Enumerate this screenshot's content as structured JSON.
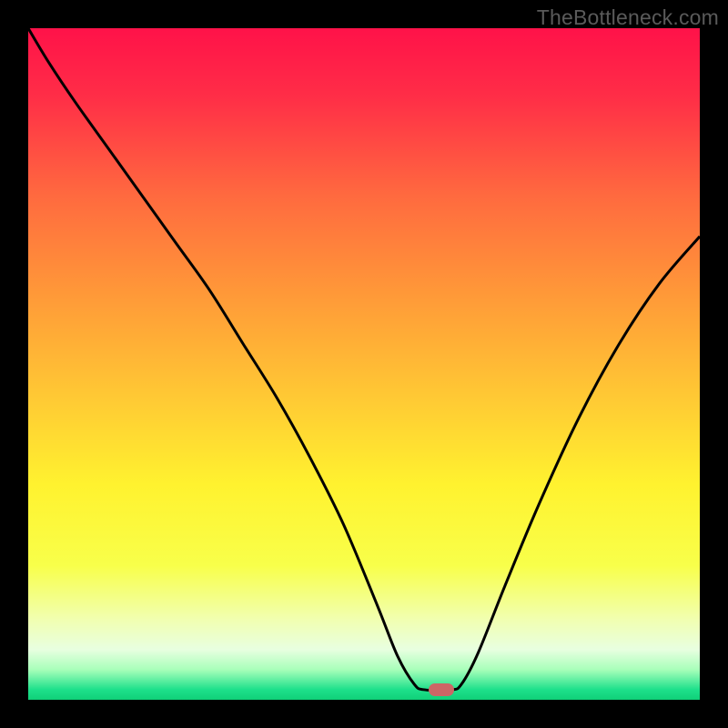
{
  "watermark": "TheBottleneck.com",
  "chart_data": {
    "type": "line",
    "title": "",
    "xlabel": "",
    "ylabel": "",
    "xlim": [
      0,
      100
    ],
    "ylim": [
      0,
      100
    ],
    "grid": false,
    "legend": false,
    "background": {
      "type": "vertical_gradient",
      "stops": [
        {
          "pos": 0.0,
          "color": "#ff1249"
        },
        {
          "pos": 0.1,
          "color": "#ff2d47"
        },
        {
          "pos": 0.25,
          "color": "#ff6a3f"
        },
        {
          "pos": 0.4,
          "color": "#ff9a38"
        },
        {
          "pos": 0.55,
          "color": "#ffc934"
        },
        {
          "pos": 0.68,
          "color": "#fff22f"
        },
        {
          "pos": 0.8,
          "color": "#f8ff4a"
        },
        {
          "pos": 0.88,
          "color": "#f1ffb0"
        },
        {
          "pos": 0.925,
          "color": "#e8ffe0"
        },
        {
          "pos": 0.955,
          "color": "#a8ffba"
        },
        {
          "pos": 0.985,
          "color": "#1de08b"
        },
        {
          "pos": 1.0,
          "color": "#10d078"
        }
      ]
    },
    "marker": {
      "x": 61.5,
      "y": 1.5,
      "color": "#cc6666"
    },
    "series": [
      {
        "name": "curve",
        "color": "#000000",
        "width": 3,
        "x": [
          0,
          3,
          7,
          12,
          17,
          22,
          27,
          32,
          37,
          42,
          47,
          52,
          55,
          57.5,
          59,
          63,
          64.5,
          67,
          71,
          76,
          82,
          88,
          94,
          100
        ],
        "y": [
          100,
          95,
          89,
          82,
          75,
          68,
          61,
          53,
          45,
          36,
          26,
          14,
          6.5,
          2.3,
          1.5,
          1.5,
          2.3,
          7,
          17,
          29,
          42,
          53,
          62,
          69
        ]
      }
    ]
  }
}
